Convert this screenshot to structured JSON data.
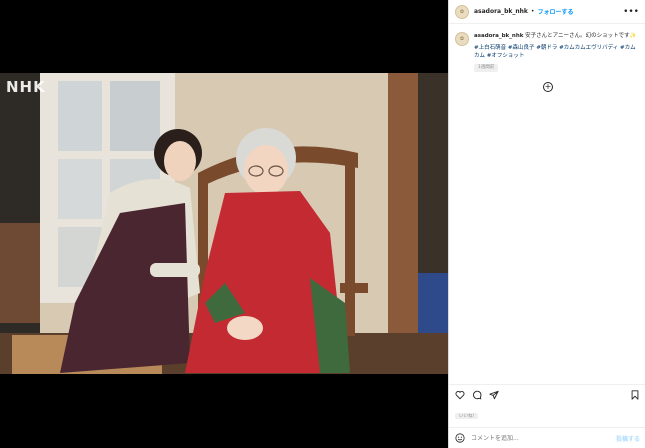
{
  "media": {
    "watermark": "NHK"
  },
  "post": {
    "username": "asadora_bk_nhk",
    "separator": "•",
    "follow_label": "フォローする",
    "more_label": "•••",
    "caption_text": "安子さんとアニーさん。幻のショットです✨",
    "hashtags": "#上白石萌音 #森山良子 #朝ドラ #カムカムエヴリバディ #カムカム #オフショット",
    "timestamp": "1週間前",
    "likes": "いいね!",
    "comment_placeholder": "コメントを追加...",
    "post_label": "投稿する"
  },
  "icons": {
    "like": "heart-icon",
    "comment": "comment-icon",
    "share": "send-icon",
    "save": "bookmark-icon",
    "emoji": "emoji-icon",
    "expand": "plus-circle-icon"
  },
  "colors": {
    "link": "#0095f6",
    "hashtag": "#00376b",
    "muted": "#8e8e8e"
  }
}
